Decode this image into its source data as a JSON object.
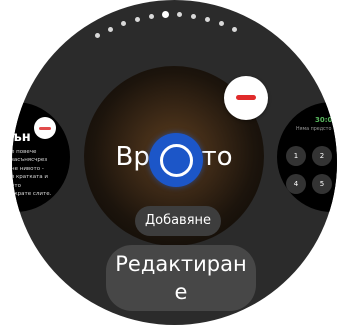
{
  "page_indicator": {
    "count": 12,
    "active_index": 6
  },
  "tile_left": {
    "title": "ън",
    "body_lines": [
      "е повече",
      "засънясчрез",
      "не нивото -",
      "в кратката и",
      "ото",
      "ократе слите."
    ]
  },
  "tile_center": {
    "label": "Времето"
  },
  "tile_right": {
    "time": "30:0",
    "subtitle": "Няма предсто",
    "keys": [
      "1",
      "2",
      "4",
      "5"
    ]
  },
  "actions": {
    "add_label": "Добавяне",
    "edit_label": "Редактиране"
  },
  "colors": {
    "remove_accent": "#e02b2b",
    "focus_blue": "#1c56c8",
    "dialer_green": "#58b65e"
  }
}
